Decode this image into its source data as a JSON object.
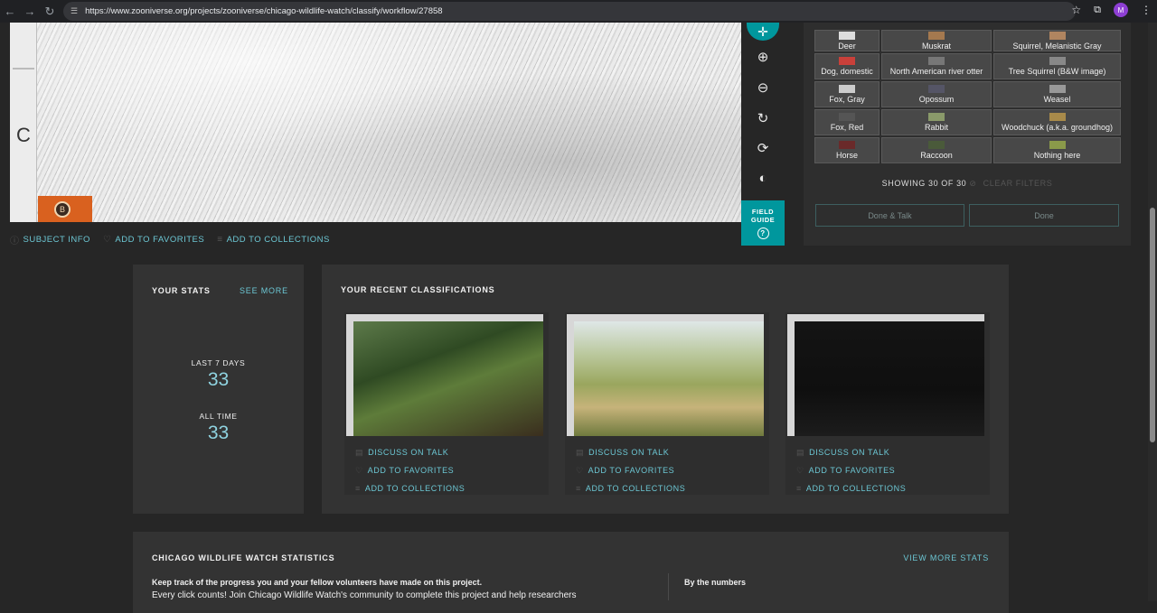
{
  "browser": {
    "url": "https://www.zooniverse.org/projects/zooniverse/chicago-wildlife-watch/classify/workflow/27858",
    "profile_initial": "M"
  },
  "subject": {
    "grid_letter": "C",
    "meta": {
      "subject_info": "SUBJECT INFO",
      "add_favorites": "ADD TO FAVORITES",
      "add_collections": "ADD TO COLLECTIONS"
    }
  },
  "toolbar": {
    "field_guide_line1": "FIELD",
    "field_guide_line2": "GUIDE",
    "field_guide_icon": "?"
  },
  "species": [
    [
      "Deer",
      "Muskrat",
      "Squirrel, Melanistic Gray"
    ],
    [
      "Dog, domestic",
      "North American river otter",
      "Tree Squirrel (B&W image)"
    ],
    [
      "Fox, Gray",
      "Opossum",
      "Weasel"
    ],
    [
      "Fox, Red",
      "Rabbit",
      "Woodchuck (a.k.a. groundhog)"
    ],
    [
      "Horse",
      "Raccoon",
      "Nothing here"
    ]
  ],
  "filters": {
    "showing": "SHOWING 30 OF 30",
    "clear": "CLEAR FILTERS"
  },
  "buttons": {
    "done_talk": "Done & Talk",
    "done": "Done"
  },
  "your_stats": {
    "title": "YOUR STATS",
    "see_more": "SEE MORE",
    "last7_label": "LAST 7 DAYS",
    "last7_value": "33",
    "alltime_label": "ALL TIME",
    "alltime_value": "33"
  },
  "recent": {
    "title": "YOUR RECENT CLASSIFICATIONS",
    "links": {
      "discuss": "DISCUSS ON TALK",
      "favorites": "ADD TO FAVORITES",
      "collections": "ADD TO COLLECTIONS"
    }
  },
  "project_stats": {
    "title": "CHICAGO WILDLIFE WATCH STATISTICS",
    "view_more": "VIEW MORE STATS",
    "lead": "Keep track of the progress you and your fellow volunteers have made on this project.",
    "body": "Every click counts! Join Chicago Wildlife Watch's community to complete this project and help researchers",
    "by_numbers": "By the numbers"
  }
}
